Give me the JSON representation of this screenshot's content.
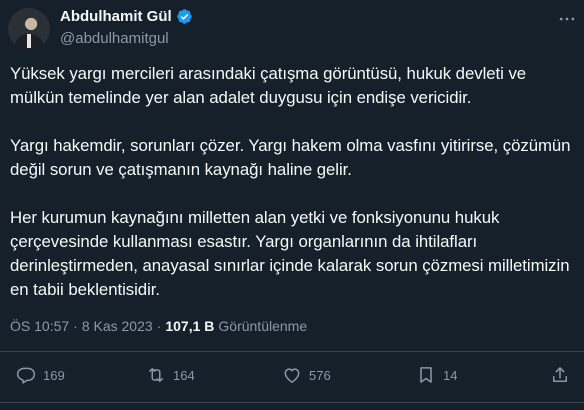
{
  "author": {
    "name": "Abdulhamit Gül",
    "handle": "@abdulhamitgul"
  },
  "tweet": {
    "paragraphs": [
      "Yüksek yargı mercileri arasındaki çatışma görüntüsü, hukuk devleti ve mülkün temelinde yer alan adalet duygusu için endişe vericidir.",
      "Yargı hakemdir, sorunları çözer. Yargı hakem olma vasfını yitirirse, çözümün değil sorun ve çatışmanın kaynağı haline gelir.",
      "Her kurumun kaynağını milletten alan yetki ve fonksiyonunu hukuk çerçevesinde kullanması esastır. Yargı organlarının da ihtilafları derinleştirmeden, anayasal sınırlar içinde kalarak sorun çözmesi milletimizin en tabii beklentisidir."
    ]
  },
  "meta": {
    "time": "ÖS 10:57",
    "sep1": "·",
    "date": "8 Kas 2023",
    "sep2": "·",
    "views": "107,1 B",
    "views_label": "Görüntülenme"
  },
  "actions": {
    "replies": "169",
    "retweets": "164",
    "likes": "576",
    "bookmarks": "14"
  },
  "colors": {
    "background": "#15202b",
    "text": "#f7f9f9",
    "secondary": "#8b98a5",
    "verified": "#1d9bf0"
  }
}
